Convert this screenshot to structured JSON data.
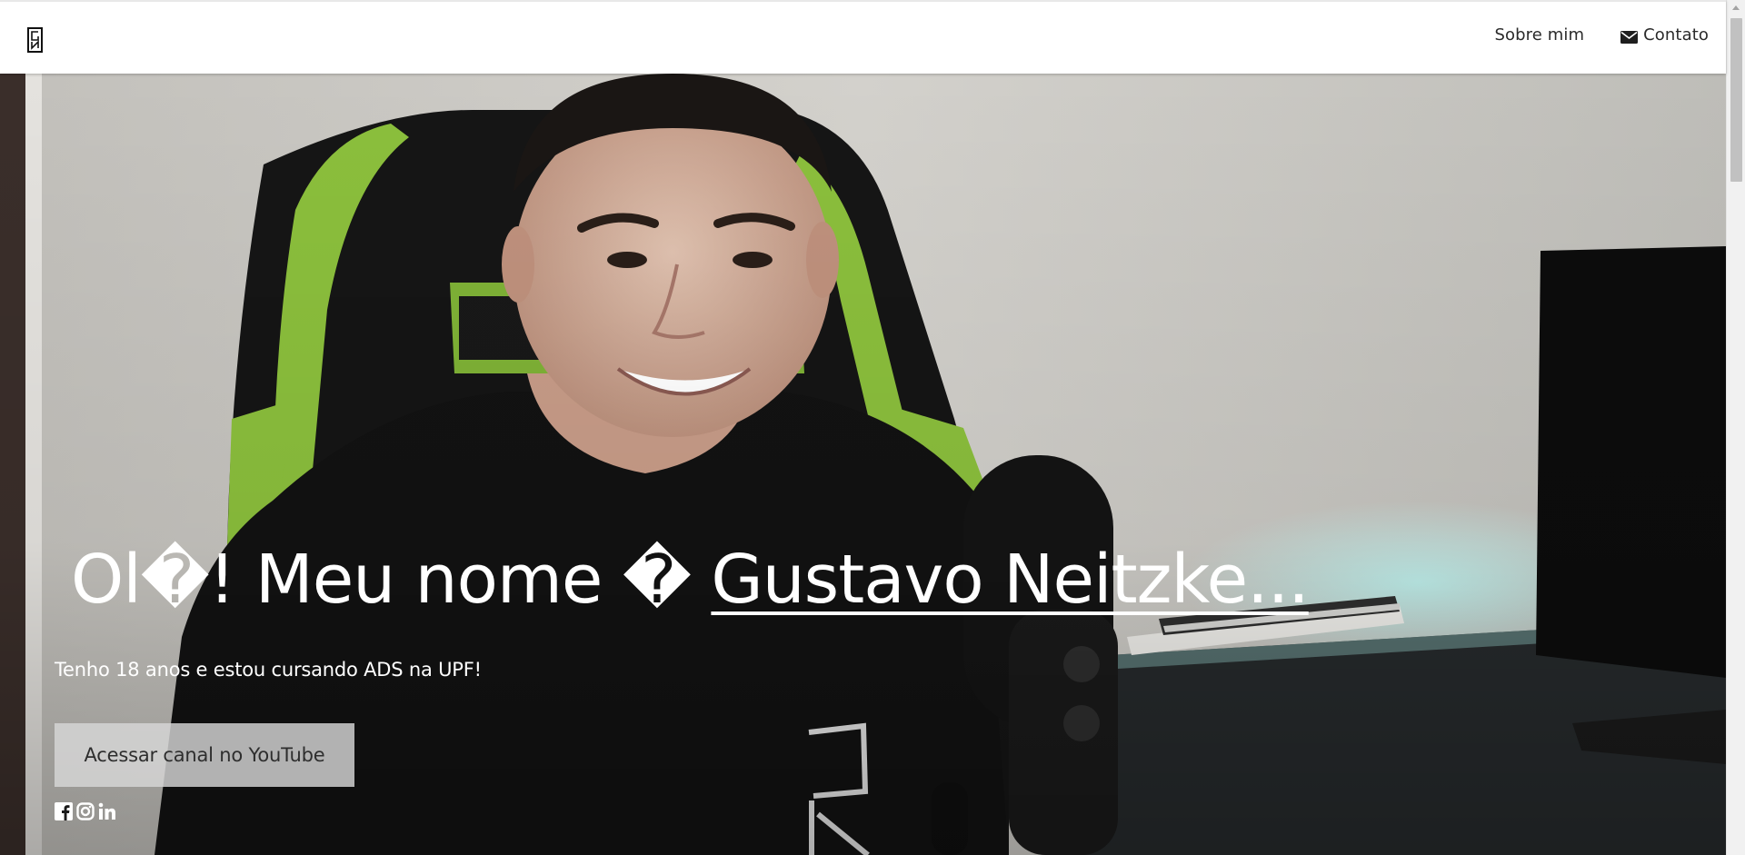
{
  "navbar": {
    "brand_icon": "gn-logo",
    "links": [
      {
        "label": "Sobre mim",
        "icon": ""
      },
      {
        "label": "Contato",
        "icon": "envelope-icon"
      }
    ]
  },
  "hero": {
    "heading_prefix": "Ol�! Meu nome � ",
    "heading_name": "Gustavo Neitzke...",
    "subtitle": "Tenho 18 anos e estou cursando ADS na UPF!",
    "button_label": "Acessar canal no YouTube",
    "social_icons": [
      "facebook-icon",
      "instagram-icon",
      "linkedin-icon"
    ]
  },
  "colors": {
    "navbar_bg": "#ffffff",
    "hero_text": "#ffffff",
    "button_bg": "#d7d7d7",
    "chair_green": "#8bbf3c"
  }
}
